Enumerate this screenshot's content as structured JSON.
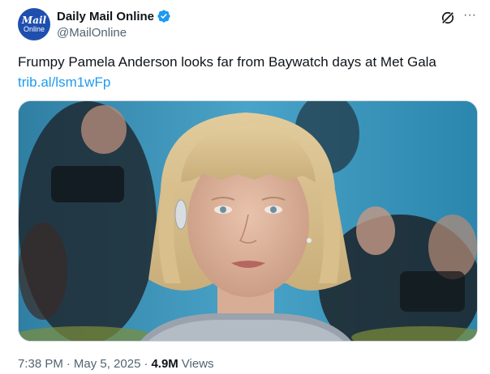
{
  "account": {
    "display_name": "Daily Mail Online",
    "handle": "@MailOnline",
    "avatar_line1": "Mail",
    "avatar_line2": "Online",
    "verified_color": "#1d9bf0"
  },
  "tweet": {
    "text": "Frumpy Pamela Anderson looks far from Baywatch days at Met Gala",
    "link": "trib.al/lsm1wFp"
  },
  "meta": {
    "time": "7:38 PM",
    "date": "May 5, 2025",
    "views_count": "4.9M",
    "views_label": "Views"
  },
  "icons": {
    "grok": "grok-icon",
    "more": "more-icon",
    "verified": "verified-badge-icon"
  },
  "more_glyph": "···",
  "separator": "·",
  "colors": {
    "link": "#1d9bf0",
    "muted": "#536471",
    "text": "#0f1419",
    "avatar_bg": "#1f4fae"
  }
}
